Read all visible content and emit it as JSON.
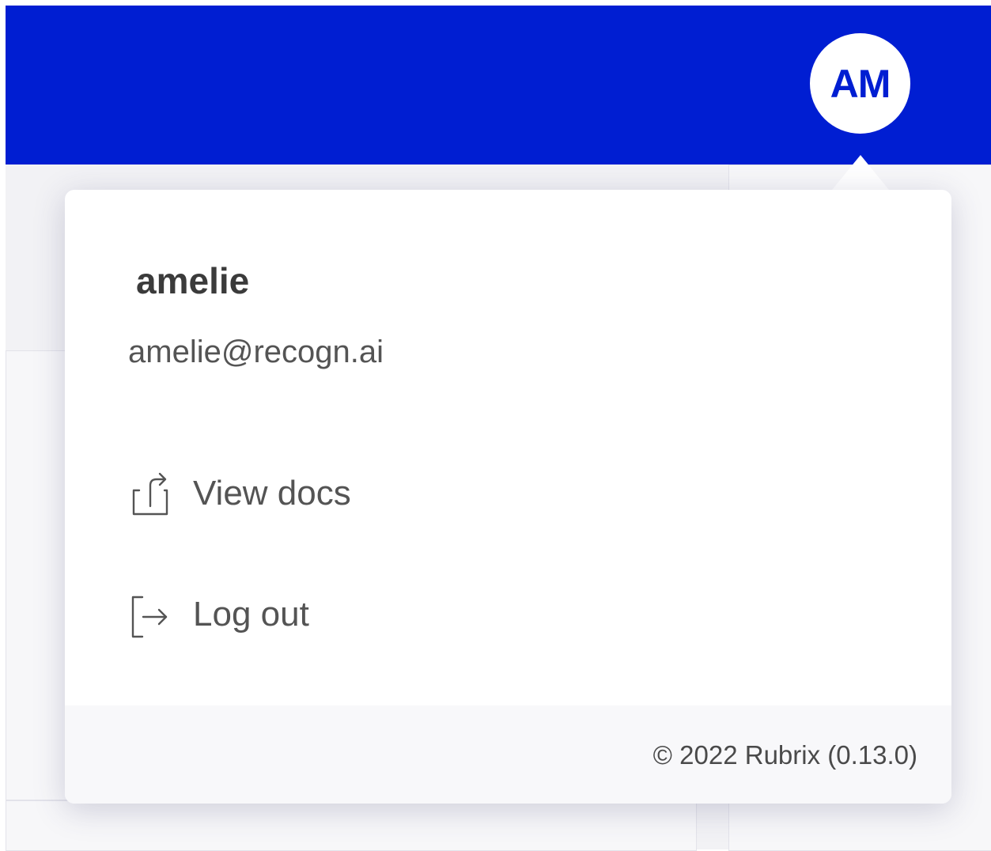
{
  "header": {
    "avatar_initials": "AM",
    "brand_color": "#001ed2"
  },
  "user_menu": {
    "username": "amelie",
    "email": "amelie@recogn.ai",
    "items": [
      {
        "label": "View docs",
        "icon": "external-share-icon"
      },
      {
        "label": "Log out",
        "icon": "logout-icon"
      }
    ],
    "footer": {
      "copyright": "© 2022 Rubrix (0.13.0)"
    }
  }
}
